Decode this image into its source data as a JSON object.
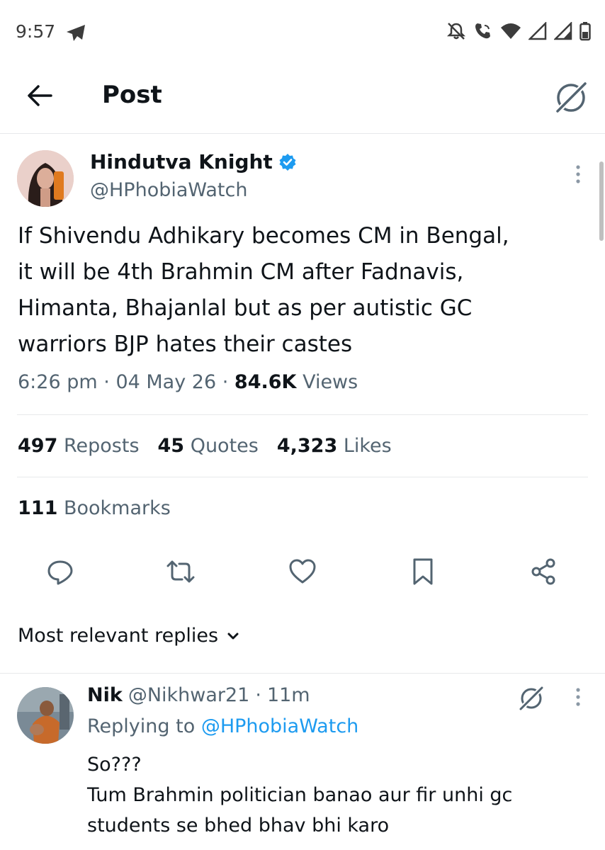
{
  "status_bar": {
    "time": "9:57"
  },
  "header": {
    "title": "Post"
  },
  "post": {
    "author_name": "Hindutva Knight",
    "author_handle": "@HPhobiaWatch",
    "text_lines": [
      "If Shivendu Adhikary becomes CM in Bengal,",
      "it will be 4th Brahmin CM after Fadnavis,",
      "Himanta, Bhajanlal but as per autistic GC",
      "warriors BJP hates their castes"
    ],
    "time": "6:26 pm",
    "sep": "·",
    "date": "04 May 26",
    "views_count": "84.6K",
    "views_label": "Views",
    "reposts_count": "497",
    "reposts_label": "Reposts",
    "quotes_count": "45",
    "quotes_label": "Quotes",
    "likes_count": "4,323",
    "likes_label": "Likes",
    "bookmarks_count": "111",
    "bookmarks_label": "Bookmarks"
  },
  "replies": {
    "sort_label": "Most relevant replies",
    "items": [
      {
        "name": "Nik",
        "handle": "@Nikhwar21",
        "sep": "·",
        "age": "11m",
        "replying_prefix": "Replying to",
        "replying_handle": "@HPhobiaWatch",
        "text_lines": [
          "So???",
          "Tum Brahmin politician banao aur fir unhi gc",
          "students se bhed bhav bhi karo"
        ]
      }
    ]
  },
  "colors": {
    "accent": "#1d9bf0",
    "muted": "#536471",
    "text": "#0f1419"
  },
  "icons": [
    "telegram-icon",
    "mute-icon",
    "wifi-calling-icon",
    "wifi-icon",
    "signal-icon",
    "battery-icon",
    "back-arrow-icon",
    "grok-icon",
    "verified-badge-icon",
    "more-vertical-icon",
    "reply-icon",
    "repost-icon",
    "like-icon",
    "bookmark-icon",
    "share-icon",
    "chevron-down-icon"
  ]
}
